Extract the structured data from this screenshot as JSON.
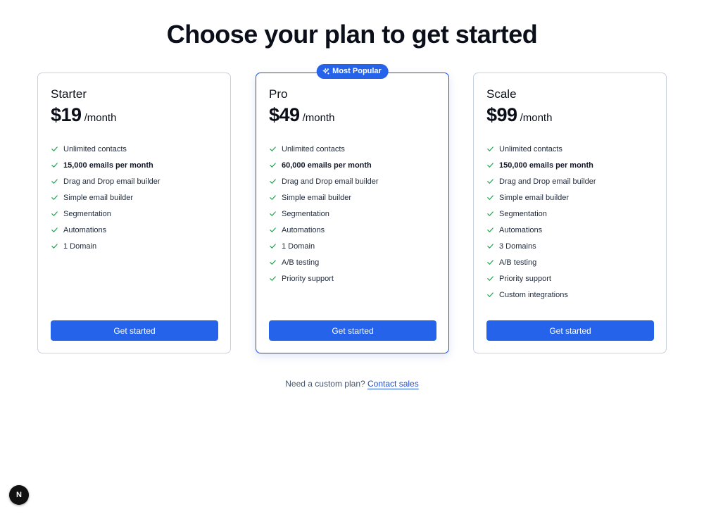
{
  "headline": "Choose your plan to get started",
  "accent_color": "#2563eb",
  "check_color": "#16a34a",
  "plans": [
    {
      "name": "Starter",
      "price": "$19",
      "period": "/month",
      "cta": "Get started",
      "features": [
        {
          "text": "Unlimited contacts",
          "strong": false
        },
        {
          "text": "15,000 emails per month",
          "strong": true
        },
        {
          "text": "Drag and Drop email builder",
          "strong": false
        },
        {
          "text": "Simple email builder",
          "strong": false
        },
        {
          "text": "Segmentation",
          "strong": false
        },
        {
          "text": "Automations",
          "strong": false
        },
        {
          "text": "1 Domain",
          "strong": false
        }
      ]
    },
    {
      "name": "Pro",
      "price": "$49",
      "period": "/month",
      "badge": "Most Popular",
      "badge_icon": "sparkles-icon",
      "cta": "Get started",
      "features": [
        {
          "text": "Unlimited contacts",
          "strong": false
        },
        {
          "text": "60,000 emails per month",
          "strong": true
        },
        {
          "text": "Drag and Drop email builder",
          "strong": false
        },
        {
          "text": "Simple email builder",
          "strong": false
        },
        {
          "text": "Segmentation",
          "strong": false
        },
        {
          "text": "Automations",
          "strong": false
        },
        {
          "text": "1 Domain",
          "strong": false
        },
        {
          "text": "A/B testing",
          "strong": false
        },
        {
          "text": "Priority support",
          "strong": false
        }
      ]
    },
    {
      "name": "Scale",
      "price": "$99",
      "period": "/month",
      "cta": "Get started",
      "features": [
        {
          "text": "Unlimited contacts",
          "strong": false
        },
        {
          "text": "150,000 emails per month",
          "strong": true
        },
        {
          "text": "Drag and Drop email builder",
          "strong": false
        },
        {
          "text": "Simple email builder",
          "strong": false
        },
        {
          "text": "Segmentation",
          "strong": false
        },
        {
          "text": "Automations",
          "strong": false
        },
        {
          "text": "3 Domains",
          "strong": false
        },
        {
          "text": "A/B testing",
          "strong": false
        },
        {
          "text": "Priority support",
          "strong": false
        },
        {
          "text": "Custom integrations",
          "strong": false
        }
      ]
    }
  ],
  "footer": {
    "prompt": "Need a custom plan?",
    "link": "Contact sales"
  },
  "dev_badge": {
    "label": "N",
    "icon": "nextjs-logo-icon"
  }
}
